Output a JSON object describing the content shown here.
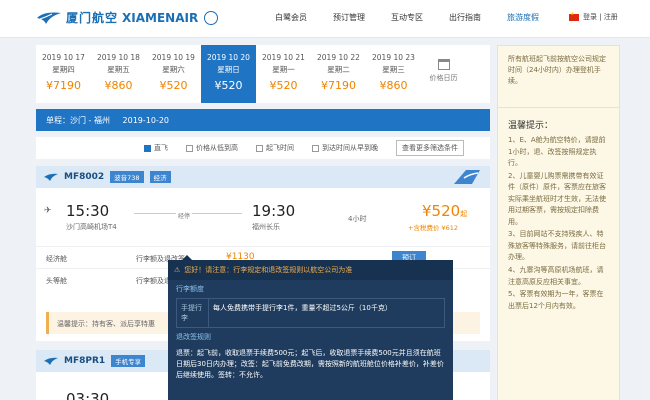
{
  "header": {
    "logo_cn": "厦门航空",
    "logo_en": "XIAMENAIR",
    "nav": [
      "白鹭会员",
      "预订管理",
      "互动专区",
      "出行指南",
      "旅游度假"
    ],
    "active_nav": 4,
    "region": "中国",
    "lang": "登录 | 注册"
  },
  "dates": [
    {
      "date": "2019 10 17",
      "weekday": "星期四",
      "price": "¥7190"
    },
    {
      "date": "2019 10 18",
      "weekday": "星期五",
      "price": "¥860"
    },
    {
      "date": "2019 10 19",
      "weekday": "星期六",
      "price": "¥520"
    },
    {
      "date": "2019 10 20",
      "weekday": "星期日",
      "price": "¥520"
    },
    {
      "date": "2019 10 21",
      "weekday": "星期一",
      "price": "¥520"
    },
    {
      "date": "2019 10 22",
      "weekday": "星期二",
      "price": "¥7190"
    },
    {
      "date": "2019 10 23",
      "weekday": "星期三",
      "price": "¥860"
    }
  ],
  "selected_date_index": 3,
  "calendar_label": "价格日历",
  "route": {
    "trip": "单程：沙门 - 福州",
    "date": "2019-10-20"
  },
  "filters": [
    {
      "label": "直飞",
      "on": true
    },
    {
      "label": "价格从低到高",
      "on": false
    },
    {
      "label": "起飞时间",
      "on": false
    },
    {
      "label": "到达时间从早到晚",
      "on": false
    }
  ],
  "filter_button": "查看更多筛选条件",
  "flight1": {
    "number": "MF8002",
    "aircraft": "波音738",
    "tag": "经济",
    "dep_time": "15:30",
    "dep_port": "沙门高崎机场T4",
    "arr_time": "19:30",
    "arr_port": "福州长乐",
    "stop_label": "经停",
    "duration": "4小时",
    "price": "¥520",
    "price_suffix": "起",
    "price_sub": "+含税费价 ¥612",
    "fares": [
      {
        "label": "经济舱",
        "rule": "行李额及退改签",
        "price": "¥1130",
        "button": "预订"
      },
      {
        "label": "头等舱",
        "rule": "行李额及退改签",
        "price": "",
        "button": ""
      }
    ],
    "notice": "温馨提示：持有客、派后享特惠"
  },
  "flight2": {
    "number": "MF8PR1",
    "tag": "手机专享",
    "dep_time": "03:30"
  },
  "side": {
    "top_text": "所有航班起飞前按航空公司规定时间（24小时内）办理登机手续。",
    "title": "温馨提示：",
    "items": [
      "1、E、A舱为航空特价，请提前1小时，退、改签按照规定执行。",
      "2、儿童婴儿购票需携带有效证件（原件）原件，客票应在旅客实际乘坐航班时才生效，无法使用过期客票，需按规定扣除费用。",
      "3、目前网站不支持残疾人、特殊旅客等特殊服务，请前往柜台办理。",
      "4、九寨沟等高原机场航班，请注意高原反应相关事宜。",
      "5、客票有效期为一年，客票在出票后12个月内有效。"
    ]
  },
  "tooltip": {
    "head": "您好！请注意：行李规定和退改签规则以航空公司为准",
    "sec1": "行李额度",
    "row_key": "手提行李",
    "row_val": "每人免费携带手提行李1件，重量不超过5公斤（10千克）",
    "sec2": "退改签规则",
    "body": "退票：起飞前，收取退票手续费500元；起飞后，收取退票手续费500元并且须在航班日期后30日内办理；改签：起飞前免费改期，需按照新的航班舱位价格补差价，补差价后继续使用。签转：不允许。"
  }
}
